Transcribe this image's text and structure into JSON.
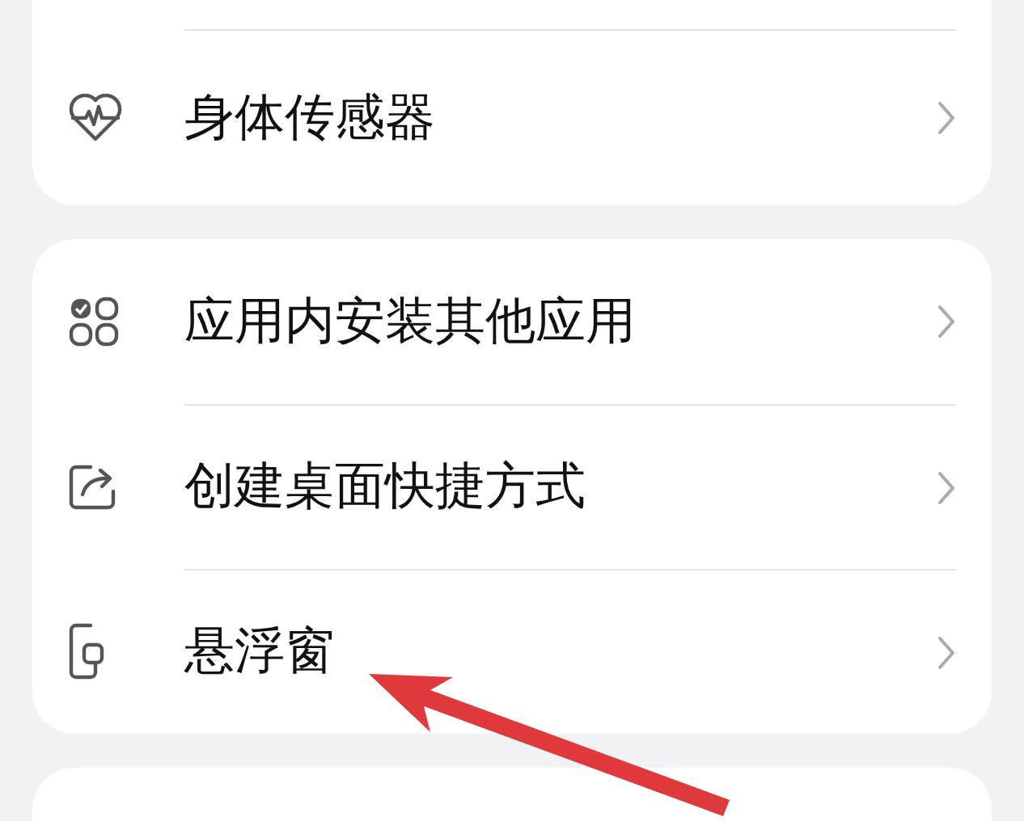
{
  "groups": [
    {
      "items": [
        {
          "label": "身体传感器"
        }
      ]
    },
    {
      "items": [
        {
          "label": "应用内安装其他应用"
        },
        {
          "label": "创建桌面快捷方式"
        },
        {
          "label": "悬浮窗"
        }
      ]
    }
  ]
}
